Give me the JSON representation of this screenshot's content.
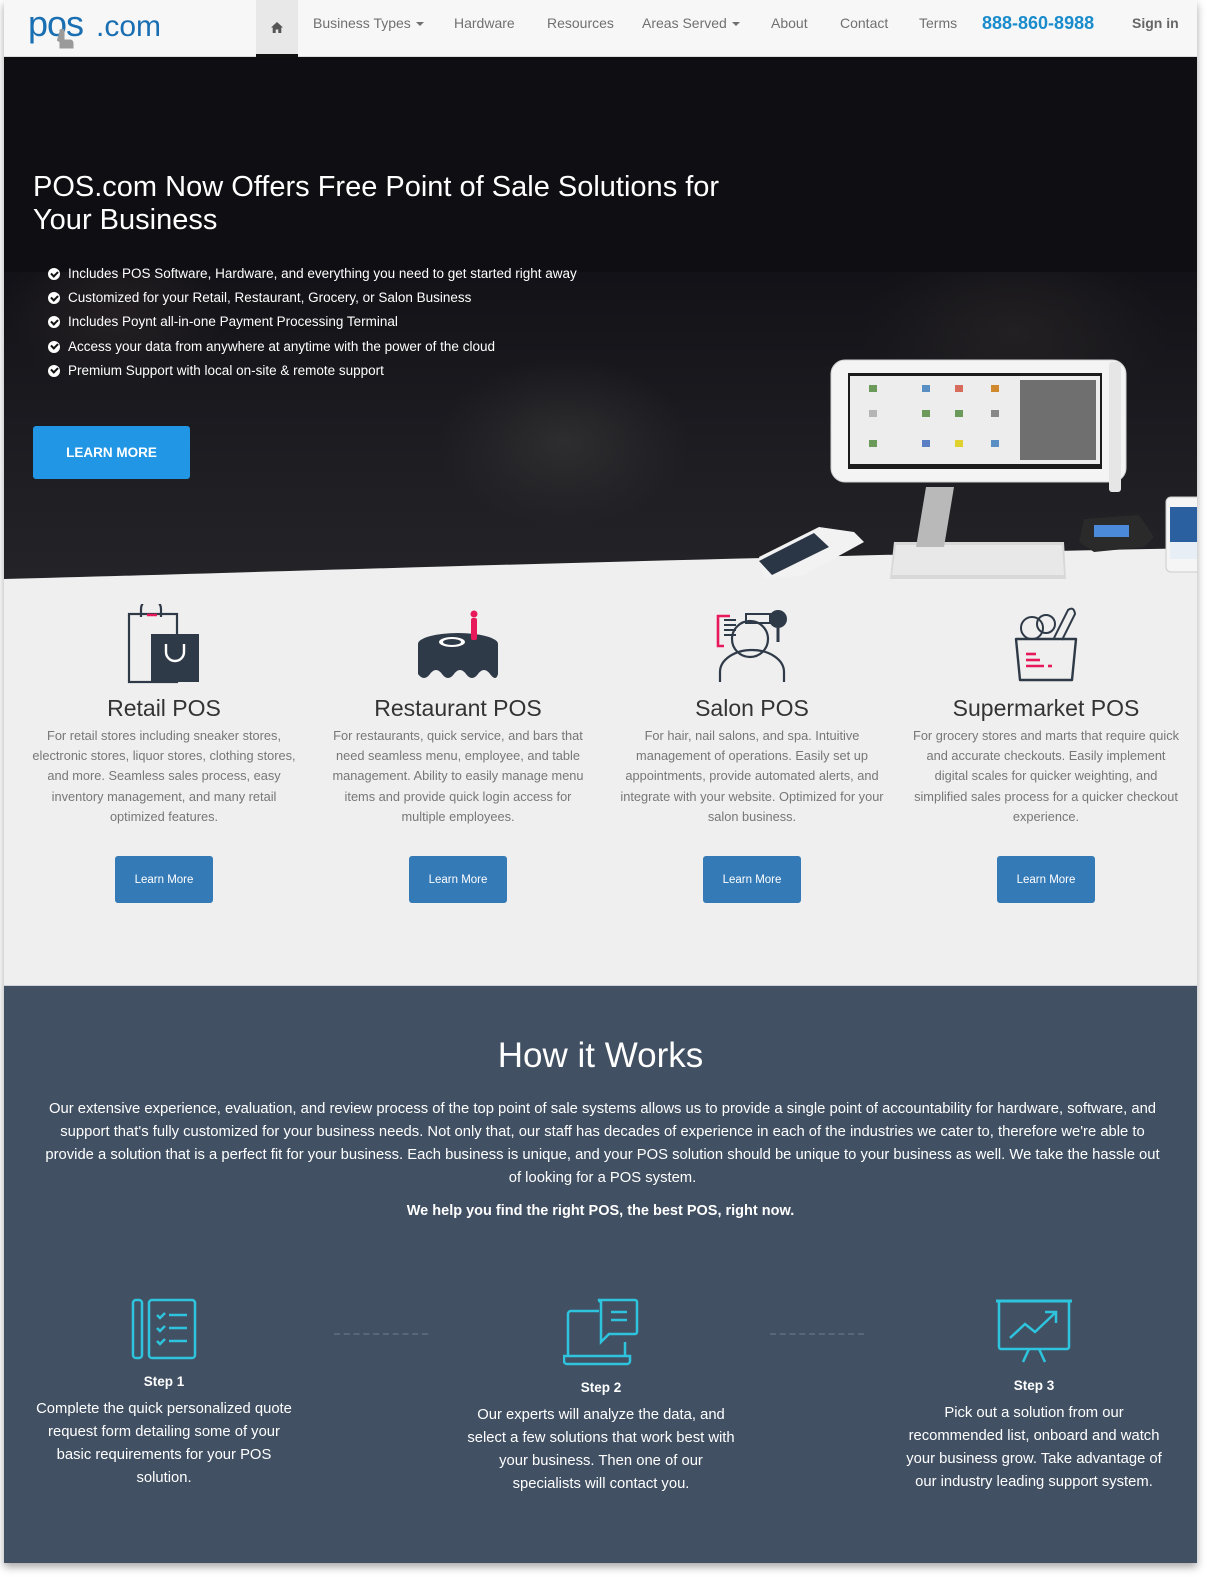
{
  "nav": {
    "logo_text": "pos.com",
    "home_icon": "home-icon",
    "items": [
      {
        "label": "Business Types",
        "dropdown": true
      },
      {
        "label": "Hardware",
        "dropdown": false
      },
      {
        "label": "Resources",
        "dropdown": false
      },
      {
        "label": "Areas Served",
        "dropdown": true
      },
      {
        "label": "About",
        "dropdown": false
      },
      {
        "label": "Contact",
        "dropdown": false
      },
      {
        "label": "Terms",
        "dropdown": false
      }
    ],
    "phone": "888-860-8988",
    "signin": "Sign in"
  },
  "hero": {
    "title": "POS.com Now Offers Free Point of Sale Solutions for Your Business",
    "features": [
      "Includes POS Software, Hardware, and everything you need to get started right away",
      "Customized for your Retail, Restaurant, Grocery, or Salon Business",
      "Includes Poynt all-in-one Payment Processing Terminal",
      "Access your data from anywhere at anytime with the power of the cloud",
      "Premium Support with local on-site & remote support"
    ],
    "cta_label": "LEARN MORE",
    "image_alt": "POS terminal, payment devices and phone"
  },
  "business_types": [
    {
      "icon": "shopping-bags-icon",
      "title": "Retail POS",
      "description": "For retail stores including sneaker stores, electronic stores, liquor stores, clothing stores, and more. Seamless sales process, easy inventory management, and many retail optimized features.",
      "button": "Learn More"
    },
    {
      "icon": "restaurant-table-icon",
      "title": "Restaurant POS",
      "description": "For restaurants, quick service, and bars that need seamless menu, employee, and table management. Ability to easily manage menu items and provide quick login access for multiple employees.",
      "button": "Learn More"
    },
    {
      "icon": "salon-hairdryer-icon",
      "title": "Salon POS",
      "description": "For hair, nail salons, and spa. Intuitive management of operations. Easily set up appointments, provide automated alerts, and integrate with your website. Optimized for your salon business.",
      "button": "Learn More"
    },
    {
      "icon": "grocery-bag-icon",
      "title": "Supermarket POS",
      "description": "For grocery stores and marts that require quick and accurate checkouts. Easily implement digital scales for quicker weighting, and simplified sales process for a quicker checkout experience.",
      "button": "Learn More"
    }
  ],
  "how_it_works": {
    "title": "How it Works",
    "body": "Our extensive experience, evaluation, and review process of the top point of sale systems allows us to provide a single point of accountability for hardware, software, and support that's fully customized for your business needs. Not only that, our staff has decades of experience in each of the industries we cater to, therefore we're able to provide a solution that is a perfect fit for your business. Each business is unique, and your POS solution should be unique to your business as well. We take the hassle out of looking for a POS system.",
    "tagline": "We help you find the right POS, the best POS, right now.",
    "steps": [
      {
        "icon": "checklist-icon",
        "label": "Step 1",
        "text": "Complete the quick personalized quote request form detailing some of your basic requirements for your POS solution."
      },
      {
        "icon": "laptop-chat-icon",
        "label": "Step 2",
        "text": "Our experts will analyze the data, and select a few solutions that work best with your business. Then one of our specialists will contact you."
      },
      {
        "icon": "presentation-chart-icon",
        "label": "Step 3",
        "text": "Pick out a solution from our recommended list, onboard and watch your business grow. Take advantage of our industry leading support system."
      }
    ]
  },
  "colors": {
    "brand_blue": "#1a8ccc",
    "cta_blue": "#2196e5",
    "button_blue": "#337ab7",
    "accent_pink": "#e8195a",
    "step_icon_cyan": "#2ec4dd",
    "how_bg": "#415063",
    "hero_bg": "#0e0e13"
  }
}
